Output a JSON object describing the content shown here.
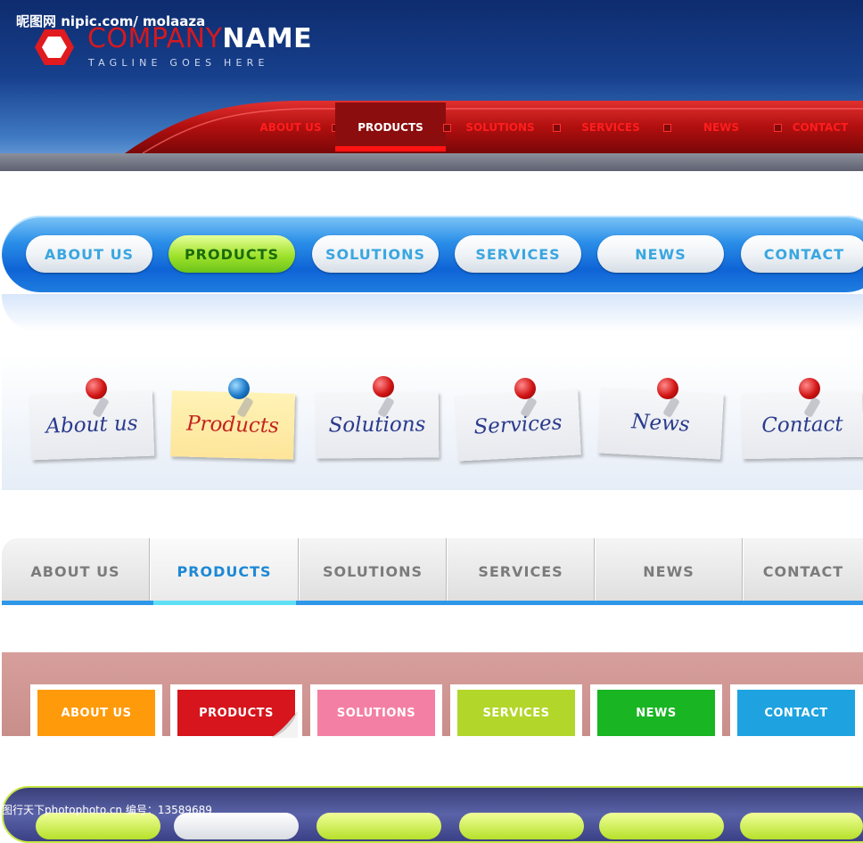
{
  "header1": {
    "watermark": "昵图网 nipic.com/ molaaza",
    "company_part1": "COMPANY",
    "company_part2": "NAME",
    "tagline": "TAGLINE GOES HERE",
    "nav": [
      "ABOUT US",
      "PRODUCTS",
      "SOLUTIONS",
      "SERVICES",
      "NEWS",
      "CONTACT"
    ],
    "active": "PRODUCTS"
  },
  "menu2": {
    "items": [
      "ABOUT US",
      "PRODUCTS",
      "SOLUTIONS",
      "SERVICES",
      "NEWS",
      "CONTACT"
    ],
    "active": "PRODUCTS"
  },
  "menu3": {
    "items": [
      "About us",
      "Products",
      "Solutions",
      "Services",
      "News",
      "Contact"
    ],
    "active": "Products"
  },
  "menu4": {
    "items": [
      "ABOUT US",
      "PRODUCTS",
      "SOLUTIONS",
      "SERVICES",
      "NEWS",
      "CONTACT"
    ],
    "active": "PRODUCTS"
  },
  "menu5": {
    "items": [
      "ABOUT US",
      "PRODUCTS",
      "SOLUTIONS",
      "SERVICES",
      "NEWS",
      "CONTACT"
    ],
    "colors": [
      "#ff9a0a",
      "#d6151c",
      "#f47fa4",
      "#b3d62a",
      "#19b522",
      "#1ea3e0"
    ]
  },
  "footer": {
    "watermark": "图行天下photophoto.cn   编号：13589689"
  },
  "colors": {
    "header_red": "#d5191f",
    "active_blue": "#1d88d6",
    "active_green": "#9fe22b"
  }
}
